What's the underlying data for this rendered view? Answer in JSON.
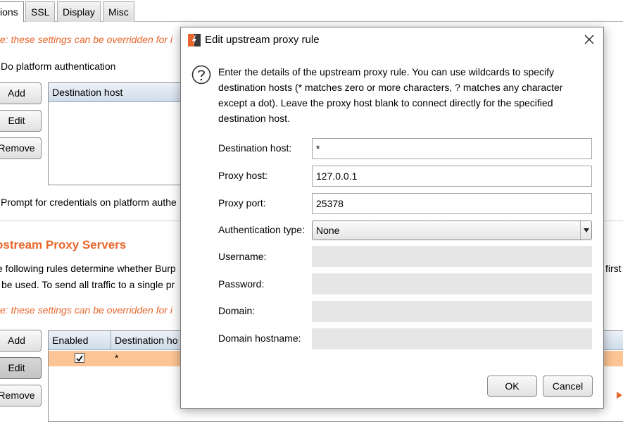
{
  "background": {
    "tabs": [
      "ions",
      "SSL",
      "Display",
      "Misc"
    ],
    "platform_auth": {
      "note": "te: these settings can be overridden for i",
      "do_platform_auth_label": "Do platform authentication",
      "buttons": {
        "add": "Add",
        "edit": "Edit",
        "remove": "Remove"
      },
      "table_header": "Destination host",
      "prompt_label": "Prompt for credentials on platform authe"
    },
    "upstream": {
      "title": "ostream Proxy Servers",
      "desc_line1": "e following rules determine whether Burp",
      "desc_line2": "be used. To send all traffic to a single pr",
      "desc_right_fragment": "first",
      "note": "te: these settings can be overridden for i",
      "buttons": {
        "add": "Add",
        "edit": "Edit",
        "remove": "Remove"
      },
      "table_headers": {
        "enabled": "Enabled",
        "destination": "Destination ho"
      },
      "rows": [
        {
          "enabled": true,
          "destination": "*"
        }
      ]
    }
  },
  "dialog": {
    "title": "Edit upstream proxy rule",
    "description": "Enter the details of the upstream proxy rule. You can use wildcards to specify destination hosts (* matches zero or more characters, ? matches any character except a dot). Leave the proxy host blank to connect directly for the specified destination host.",
    "fields": {
      "destination_host": {
        "label": "Destination host:",
        "value": "*"
      },
      "proxy_host": {
        "label": "Proxy host:",
        "value": "127.0.0.1"
      },
      "proxy_port": {
        "label": "Proxy port:",
        "value": "25378"
      },
      "auth_type": {
        "label": "Authentication type:",
        "value": "None"
      },
      "username": {
        "label": "Username:",
        "value": ""
      },
      "password": {
        "label": "Password:",
        "value": ""
      },
      "domain": {
        "label": "Domain:",
        "value": ""
      },
      "domain_hostname": {
        "label": "Domain hostname:",
        "value": ""
      }
    },
    "buttons": {
      "ok": "OK",
      "cancel": "Cancel"
    },
    "icons": {
      "logo": "burp-logo-icon",
      "close": "close-icon",
      "help": "help-question-icon"
    },
    "colors": {
      "accent": "#e8662c",
      "selected_row": "#fdc495"
    }
  }
}
